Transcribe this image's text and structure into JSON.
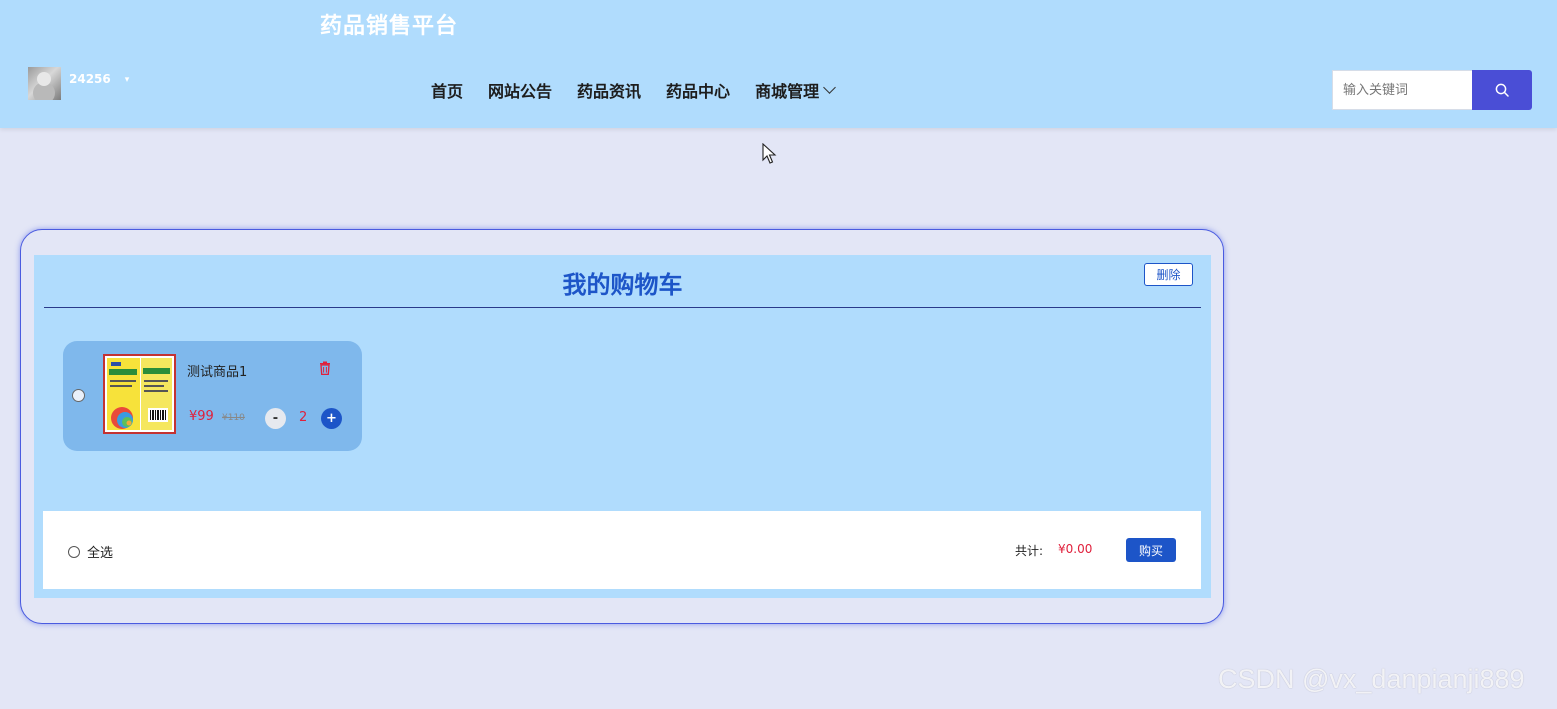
{
  "header": {
    "site_title": "药品销售平台",
    "user": {
      "name": "24256",
      "caret": "▾"
    },
    "nav": [
      {
        "label": "首页"
      },
      {
        "label": "网站公告"
      },
      {
        "label": "药品资讯"
      },
      {
        "label": "药品中心"
      },
      {
        "label": "商城管理",
        "dropdown": true
      }
    ],
    "search": {
      "placeholder": "输入关键词",
      "value": ""
    }
  },
  "cart": {
    "title": "我的购物车",
    "delete_label": "删除",
    "items": [
      {
        "name": "测试商品1",
        "price": "¥99",
        "original_price": "¥110",
        "quantity": "2",
        "minus": "-",
        "plus": "+",
        "selected": false
      }
    ],
    "footer": {
      "select_all_label": "全选",
      "total_label": "共计:",
      "total_value": "¥0.00",
      "buy_label": "购买"
    }
  },
  "watermark": "CSDN @vx_danpianji889",
  "colors": {
    "header_bg": "#b0dcfd",
    "page_bg": "#e3e6f6",
    "accent": "#1d55c8",
    "search_button": "#4a4ed6",
    "price": "#e0203c"
  }
}
